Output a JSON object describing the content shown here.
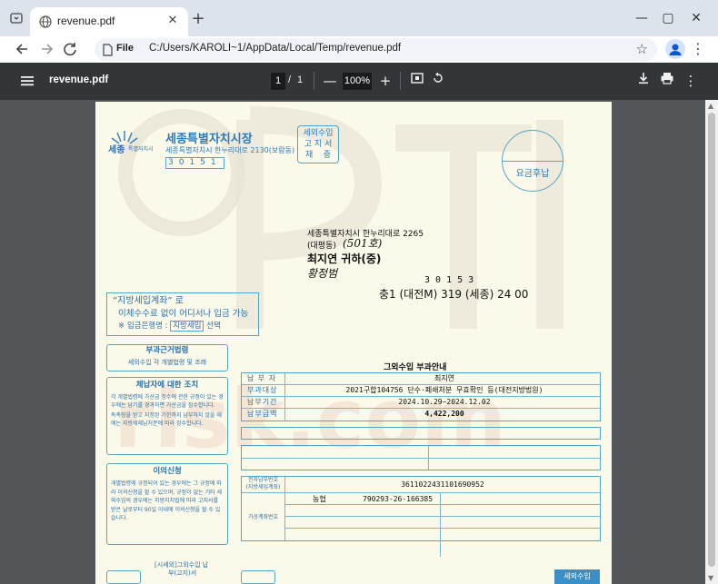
{
  "browser": {
    "tab_title": "revenue.pdf",
    "file_label": "File",
    "url": "C:/Users/KAROLI~1/AppData/Local/Temp/revenue.pdf",
    "window_controls": [
      "minimize-icon",
      "maximize-icon",
      "close-icon"
    ]
  },
  "pdf_toolbar": {
    "doc_name": "revenue.pdf",
    "current_page": "1",
    "page_separator": "/",
    "total_pages": "1",
    "zoom": "100%"
  },
  "document": {
    "sender_org": "세종특별자치시장",
    "sender_logo_text": "세종",
    "sender_logo_sub": "특별자치시",
    "sender_address": "세종특별자치시 한누리대로 2130(보람동)",
    "sender_postcode": "30151",
    "stamp_lines": [
      "세외수입",
      "고 지 서",
      "재    중"
    ],
    "postage_mark": "요금후납",
    "recipient_address": "세종특별자치시  한누리대로 2265",
    "recipient_district": "(대평동)",
    "recipient_handwritten_1": "(501호)",
    "recipient_name": "최지연 귀하(중)",
    "recipient_handwritten_2": "황정범",
    "recipient_postcode": "3 0 1 5 3",
    "sorting_code": "충1 (대전M) 319 (세종) 24 00",
    "bank_box": {
      "line1": "“지방세입계좌” 로",
      "line2": "이체수수료 없이 어디서나 입금 가능",
      "line3_prefix": "※ 입금은행명 : ",
      "line3_highlight": "지방세입",
      "line3_suffix": " 선택"
    },
    "legal_basis": {
      "title": "부과근거법령",
      "body": "세외수입 각 개별법령 및 조례"
    },
    "delinquency": {
      "title": "체납자에 대한 조치",
      "items": [
        "각 개별법령에 가산금 징수에 관한 규정이 있는 경우에는 납기를 경과하면 가산금을 징수합니다.",
        "독촉장을 받고 지정된 기한까지 납부하지 않을 때에는 지방세체납처분에 따라 징수합니다."
      ]
    },
    "objection": {
      "title": "이의신청",
      "body": "개별법령에 규정되어 있는 경우에는 그 규정에 따라 이의신청을 할 수 있으며, 규정이 없는 기타 세외수입의 경우에는 지방자치법에 따라 고지서를 받은 날로부터 90일 이내에 이의신청을 할 수 있습니다."
    },
    "notice_title": "그외수입 부과안내",
    "notice_rows": [
      {
        "label": "납 부 자",
        "value": "최지연"
      },
      {
        "label": "부과대상",
        "value": "2021구합104756 단수·폐쇄처분 무효확인 등(대전지방법원)"
      },
      {
        "label": "납부기간",
        "value": "2024.10.29~2024.12.02"
      },
      {
        "label": "납부금액",
        "value": "4,422,200"
      }
    ],
    "account_label": "전자납부번호\n(지방세입계좌)",
    "account_number": "3611022431101690952",
    "virtual_label": "가상계좌번호",
    "bank_name": "농협",
    "virtual_account": "790293-26-166385",
    "footer_left": "[시세외]그외수입 납",
    "footer_left2": "부(고지)서",
    "footer_right": "세외수입"
  }
}
